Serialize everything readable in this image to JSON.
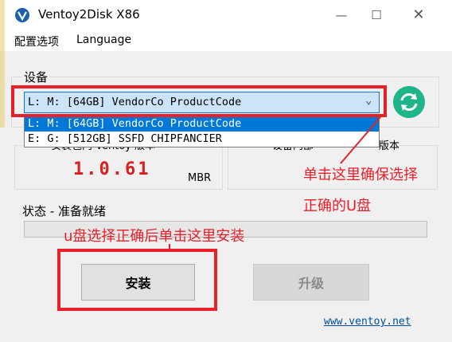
{
  "window": {
    "title": "Ventoy2Disk  X86",
    "min_symbol": "—",
    "max_symbol": "☐",
    "close_symbol": "✕"
  },
  "menu": {
    "options": "配置选项",
    "language": "Language"
  },
  "device": {
    "label": "设备",
    "selected": "L: M: [64GB] VendorCo ProductCode",
    "arrow": "⌄",
    "options": [
      "L: M: [64GB] VendorCo ProductCode",
      "E: G: [512GB] SSFD CHIPFANCIER"
    ]
  },
  "version": {
    "heading_left_partial": "安装包内 Ventoy 版本",
    "heading_right_partial": "设备内部",
    "heading_right2_partial": "版本",
    "package_version": "1.0.61",
    "partition_style": "MBR"
  },
  "status": {
    "label": "状态 - 准备就绪"
  },
  "buttons": {
    "install": "安装",
    "upgrade": "升级"
  },
  "footer": {
    "site": "www.ventoy.net"
  },
  "annotations": {
    "select_line1": "单击这里确保选择",
    "select_line2": "正确的U盘",
    "install": "u盘选择正确后单击这里安装"
  },
  "icons": {
    "app": "ventoy-logo-icon",
    "refresh": "refresh-icon"
  },
  "colors": {
    "accent": "#0078d7",
    "version_red": "#d9201f",
    "annotation_red": "#e8202a",
    "refresh_green": "#1fb48a"
  }
}
